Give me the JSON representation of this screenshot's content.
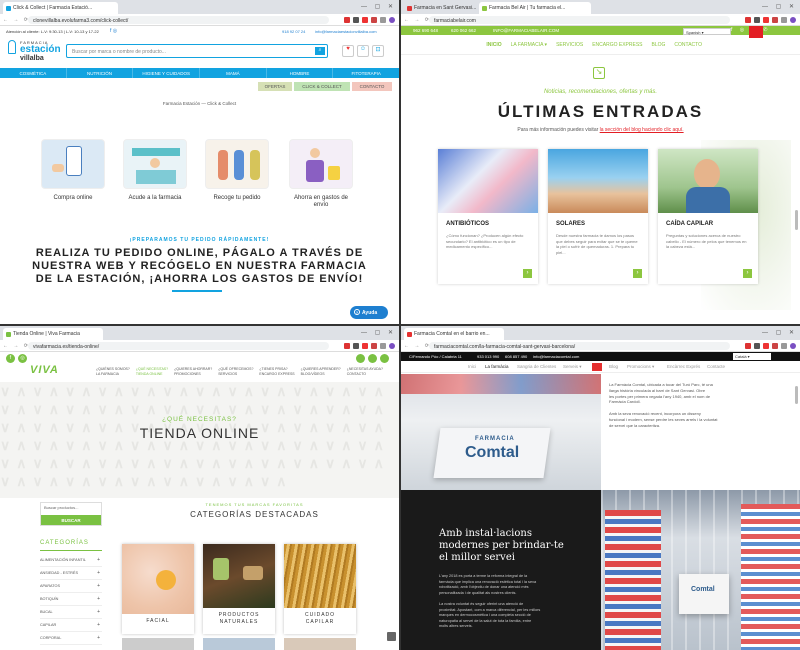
{
  "q1": {
    "tab_title": "Click & Collect | Farmacia Estació...",
    "url": "clonevillalba.evolufarma3.com/click-collect/",
    "topbar_left": "Atención al cliente: L-V: 9:30-13 | L-V: 10-13 y 17-22",
    "topbar_phone": "918 92 07 24",
    "topbar_email": "info@farmaciaestacionvillalba.com",
    "logo_top": "FARMACIA",
    "logo_mid": "estación",
    "logo_bot": "villalba",
    "search_placeholder": "Buscar por marca o nombre de producto...",
    "nav": [
      "COSMÉTICA",
      "NUTRICIÓN",
      "HIGIENE Y CUIDADOS",
      "MAMÁ",
      "HOMBRE",
      "FITOTERAPIA"
    ],
    "subnav": [
      "OFERTAS",
      "CLICK & COLLECT",
      "CONTACTO"
    ],
    "breadcrumb": "Farmacia Estación — Click & Collect",
    "steps": [
      "Compra online",
      "Acude a la farmacia",
      "Recoge tu pedido",
      "Ahorra en gastos de envío"
    ],
    "tagline": "¡PREPARAMOS TU PEDIDO RÁPIDAMENTE!",
    "headline": [
      "REALIZA TU PEDIDO ONLINE, PÁGALO A TRAVÉS DE",
      "NUESTRA WEB Y RECÓGELO EN NUESTRA FARMACIA",
      "DE LA ESTACIÓN, ¡AHORRA LOS GASTOS DE ENVÍO!"
    ],
    "help_button": "Ayuda",
    "colors": {
      "nav": "#12a3e0",
      "accent": "#1e7fd0"
    }
  },
  "q2": {
    "tab_title": "Farmacia Bel Air | Tu farmacia el...",
    "url": "farmaciabelair.com",
    "topbar_phone1": "962 690 648",
    "topbar_phone2": "620 062 662",
    "topbar_email": "INFO@FARMACIABELAIR.COM",
    "lang": "Spanish",
    "nav": [
      "INICIO",
      "LA FARMACIA",
      "SERVICIOS",
      "ENCARGO EXPRESS",
      "BLOG",
      "CONTACTO"
    ],
    "kicker": "Noticias, recomendaciones, ofertas y más.",
    "title": "ÚLTIMAS ENTRADAS",
    "lead_text": "Para más información puedes visitar ",
    "lead_link": "la sección del blog haciendo clic aquí.",
    "posts": [
      {
        "title": "ANTIBIÓTICOS",
        "excerpt": "¿Cómo funcionan? ¿Producen algún efecto secundario? El antibiótico es un tipo de medicamento específico..."
      },
      {
        "title": "SOLARES",
        "excerpt": "Desde nuestra farmacia te damos los pasos que debes seguir para evitar que se te queme la piel o sufrir de quemaduras. 1. Prepara tu piel..."
      },
      {
        "title": "CAÍDA CAPILAR",
        "excerpt": "Preguntas y soluciones acerca de nuestro cabello - El número de pelos que tenemos en la cabeza está..."
      }
    ],
    "colors": {
      "green": "#8cc63f",
      "red": "#e31e24"
    }
  },
  "q3": {
    "tab_title": "Tienda Online | Viva Farmacia",
    "url": "vivafarmacia.es/tienda-online/",
    "logo": "VIVA",
    "nav": [
      {
        "a": "¿QUIÉNES SOMOS?",
        "b": "LA FARMACIA"
      },
      {
        "a": "¿QUÉ NECESITAS?",
        "b": "TIENDA ONLINE"
      },
      {
        "a": "¿QUIERES AHORRAR?",
        "b": "PROMOCIONES"
      },
      {
        "a": "¿QUÉ OFRECEMOS?",
        "b": "SERVICIOS"
      },
      {
        "a": "¿TIENES PRISA?",
        "b": "ENCARGO EXPRESS"
      },
      {
        "a": "¿QUIERES APRENDER?",
        "b": "BLOG/VÍDEOS"
      },
      {
        "a": "¿NECESITAS AYUDA?",
        "b": "CONTACTO"
      }
    ],
    "hero_kicker": "¿QUÉ NECESITAS?",
    "hero_title": "TIENDA ONLINE",
    "search_placeholder": "Buscar productos...",
    "search_button": "BUSCAR",
    "categories_title": "CATEGORÍAS",
    "categories": [
      "ALIMENTACIÓN INFANTIL",
      "ANSIEDAD - ESTRÉS",
      "APARATOS",
      "BOTIQUÍN",
      "BUCAL",
      "CAPILAR",
      "CORPORAL"
    ],
    "brands_kicker": "TENEMOS TUS MARCAS FAVORITAS",
    "featured_title": "CATEGORÍAS DESTACADAS",
    "featured": [
      {
        "l1": "FACIAL",
        "l2": ""
      },
      {
        "l1": "PRODUCTOS",
        "l2": "NATURALES"
      },
      {
        "l1": "CUIDADO",
        "l2": "CAPILAR"
      }
    ],
    "colors": {
      "green": "#7ac142"
    }
  },
  "q4": {
    "tab_title": "Farmacia Comtal en el barrio en...",
    "url": "farmaciacomtal.com/la-farmacia-comtal-sant-gervasi-barcelona/",
    "topbar_address": "C/Fernando Póo / Calabria 11",
    "topbar_phone1": "933 013 990",
    "topbar_phone2": "608 857 490",
    "topbar_email": "info@farmaciacomtal.com",
    "lang": "Català",
    "nav": [
      "Inici",
      "La farmàcia",
      "Sangria de Clientes",
      "Serveis",
      "Blog",
      "Promocions",
      "Encàrrec Exprés",
      "Contacte"
    ],
    "sign_top": "FARMACIA",
    "sign_main": "Comtal",
    "intro": [
      "La Farmàcia Comtal, ubicada a tocar del Turó Parc, té una",
      "llarga història vinculada al barri de Sant Gervasi. Obre",
      "les portes per primera vegada l'any 1940, amb el nom de",
      "Farmàcia Cardoll.",
      "",
      "Amb la seva renovació recent, incorpora un disseny",
      "funcional i modern, sense perdre les seves arrels i la voluntat",
      "de servei que la caracteritza."
    ],
    "dark_title": [
      "Amb instal·lacions",
      "modernes per brindar-te",
      "el millor servei"
    ],
    "dark_p1": [
      "L'any 2018 es porta a terme la reforma integral de la",
      "farmàcia que implica una renovació estètica total i la seva",
      "robotització, amb l'objectiu de donar una atenció més",
      "personalitzada i de qualitat als nostres clients."
    ],
    "dark_p2": [
      "La nostra voluntat és seguir oferint una atenció de",
      "proximitat. Apostant, com a marca diferencial, per les millors",
      "marques en dermocosmètica i una completa secció de",
      "naturopatia al servei de la salut de tota la família, entre",
      "molts altres serveis."
    ],
    "colors": {
      "dark": "#1a1a1a",
      "red": "#e53030"
    }
  }
}
